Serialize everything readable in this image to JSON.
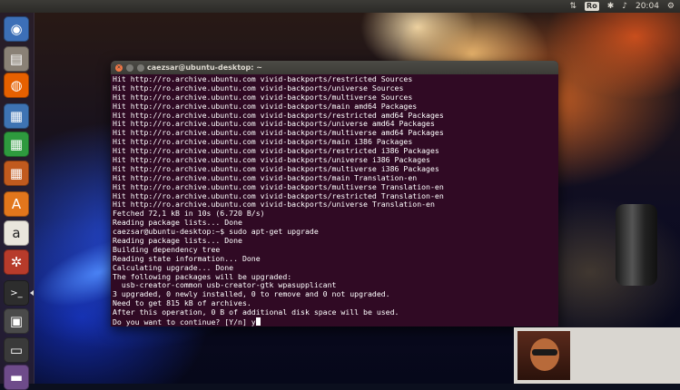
{
  "top_panel": {
    "indicators": {
      "network": "⇅",
      "keyboard_layout": "Ro",
      "bluetooth": "✱",
      "volume": "♪",
      "clock": "20:04",
      "settings": "⚙"
    }
  },
  "launcher": {
    "items": [
      {
        "name": "dash-home",
        "icon": "ubuntu-logo-icon",
        "glyph": "◉",
        "color": "#3c6fb7"
      },
      {
        "name": "files",
        "icon": "file-manager-icon",
        "glyph": "▤",
        "color": "#8a8176"
      },
      {
        "name": "firefox",
        "icon": "firefox-icon",
        "glyph": "◍",
        "color": "#e66000"
      },
      {
        "name": "libreoffice-writer",
        "icon": "writer-icon",
        "glyph": "▦",
        "color": "#3e73b3"
      },
      {
        "name": "libreoffice-calc",
        "icon": "calc-icon",
        "glyph": "▦",
        "color": "#2e9a3e"
      },
      {
        "name": "libreoffice-impress",
        "icon": "impress-icon",
        "glyph": "▦",
        "color": "#c15a1e"
      },
      {
        "name": "software-center",
        "icon": "software-center-icon",
        "glyph": "A",
        "color": "#e2761c"
      },
      {
        "name": "amazon",
        "icon": "amazon-icon",
        "glyph": "a",
        "color": "#e9e5dc"
      },
      {
        "name": "system-settings",
        "icon": "settings-icon",
        "glyph": "✲",
        "color": "#b73b2b"
      },
      {
        "name": "terminal",
        "icon": "terminal-icon",
        "glyph": ">_",
        "color": "#2d2d2d",
        "active": true
      },
      {
        "name": "workspace-switcher",
        "icon": "workspace-icon",
        "glyph": "▣",
        "color": "#4a4a4a"
      },
      {
        "name": "removable-drive",
        "icon": "drive-icon",
        "glyph": "▭",
        "color": "#3a3a3a"
      },
      {
        "name": "trash",
        "icon": "trash-icon",
        "glyph": "▬",
        "color": "#6e4b8a"
      }
    ]
  },
  "terminal": {
    "title": "caezsar@ubuntu-desktop: ~",
    "lines": [
      "Hit http://ro.archive.ubuntu.com vivid-backports/restricted Sources",
      "Hit http://ro.archive.ubuntu.com vivid-backports/universe Sources",
      "Hit http://ro.archive.ubuntu.com vivid-backports/multiverse Sources",
      "Hit http://ro.archive.ubuntu.com vivid-backports/main amd64 Packages",
      "Hit http://ro.archive.ubuntu.com vivid-backports/restricted amd64 Packages",
      "Hit http://ro.archive.ubuntu.com vivid-backports/universe amd64 Packages",
      "Hit http://ro.archive.ubuntu.com vivid-backports/multiverse amd64 Packages",
      "Hit http://ro.archive.ubuntu.com vivid-backports/main i386 Packages",
      "Hit http://ro.archive.ubuntu.com vivid-backports/restricted i386 Packages",
      "Hit http://ro.archive.ubuntu.com vivid-backports/universe i386 Packages",
      "Hit http://ro.archive.ubuntu.com vivid-backports/multiverse i386 Packages",
      "Hit http://ro.archive.ubuntu.com vivid-backports/main Translation-en",
      "Hit http://ro.archive.ubuntu.com vivid-backports/multiverse Translation-en",
      "Hit http://ro.archive.ubuntu.com vivid-backports/restricted Translation-en",
      "Hit http://ro.archive.ubuntu.com vivid-backports/universe Translation-en",
      "Fetched 72,1 kB in 10s (6.720 B/s)",
      "Reading package lists... Done",
      "caezsar@ubuntu-desktop:~$ sudo apt-get upgrade",
      "Reading package lists... Done",
      "Building dependency tree",
      "Reading state information... Done",
      "Calculating upgrade... Done",
      "The following packages will be upgraded:",
      "  usb-creator-common usb-creator-gtk wpasupplicant",
      "3 upgraded, 0 newly installed, 0 to remove and 0 not upgraded.",
      "Need to get 815 kB of archives.",
      "After this operation, 0 B of additional disk space will be used."
    ],
    "prompt_line": "Do you want to continue? [Y/n] y"
  },
  "colors": {
    "terminal_bg": "#300a24",
    "terminal_fg": "#ffffff",
    "panel_bg": "#3c3b37",
    "close_button": "#f07746"
  }
}
